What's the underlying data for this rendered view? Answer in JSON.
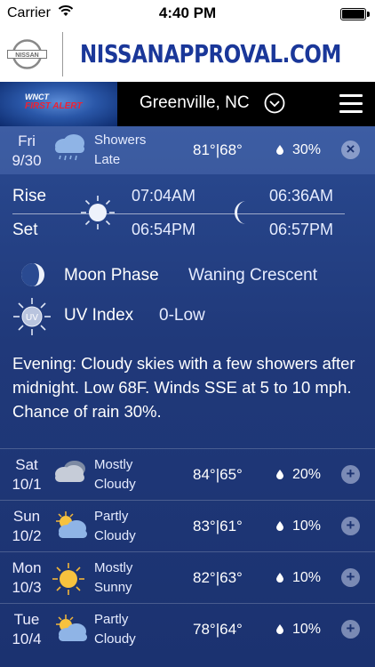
{
  "status_bar": {
    "carrier": "Carrier",
    "time": "4:40 PM"
  },
  "ad": {
    "url": "NISSANAPPROVAL.COM",
    "logo_text": "NISSAN"
  },
  "nav": {
    "brand_line1": "WNCT",
    "brand_line2": "FIRST ALERT",
    "brand_line3": "WEATHER",
    "city": "Greenville, NC"
  },
  "today": {
    "day": "Fri",
    "date": "9/30",
    "condition_line1": "Showers",
    "condition_line2": "Late",
    "high": "81°",
    "low": "68°",
    "separator": "|",
    "precip": "30%",
    "close_icon": "×",
    "rise_label": "Rise",
    "set_label": "Set",
    "sunrise": "07:04AM",
    "sunset": "06:54PM",
    "moonrise": "06:36AM",
    "moonset": "06:57PM",
    "moon_phase_label": "Moon Phase",
    "moon_phase": "Waning Crescent",
    "uv_label": "UV Index",
    "uv_value": "0-Low",
    "uv_icon_text": "UV",
    "description": "Evening: Cloudy skies with a few showers after midnight. Low 68F. Winds SSE at 5 to 10 mph. Chance of rain 30%."
  },
  "forecast": [
    {
      "day": "Sat",
      "date": "10/1",
      "cond1": "Mostly",
      "cond2": "Cloudy",
      "high": "84°",
      "low": "65°",
      "precip": "20%",
      "icon": "cloudy-icon"
    },
    {
      "day": "Sun",
      "date": "10/2",
      "cond1": "Partly",
      "cond2": "Cloudy",
      "high": "83°",
      "low": "61°",
      "precip": "10%",
      "icon": "partly-cloudy-icon"
    },
    {
      "day": "Mon",
      "date": "10/3",
      "cond1": "Mostly",
      "cond2": "Sunny",
      "high": "82°",
      "low": "63°",
      "precip": "10%",
      "icon": "sunny-icon"
    },
    {
      "day": "Tue",
      "date": "10/4",
      "cond1": "Partly",
      "cond2": "Cloudy",
      "high": "78°",
      "low": "64°",
      "precip": "10%",
      "icon": "partly-cloudy-icon"
    }
  ],
  "expand_icon": "+"
}
